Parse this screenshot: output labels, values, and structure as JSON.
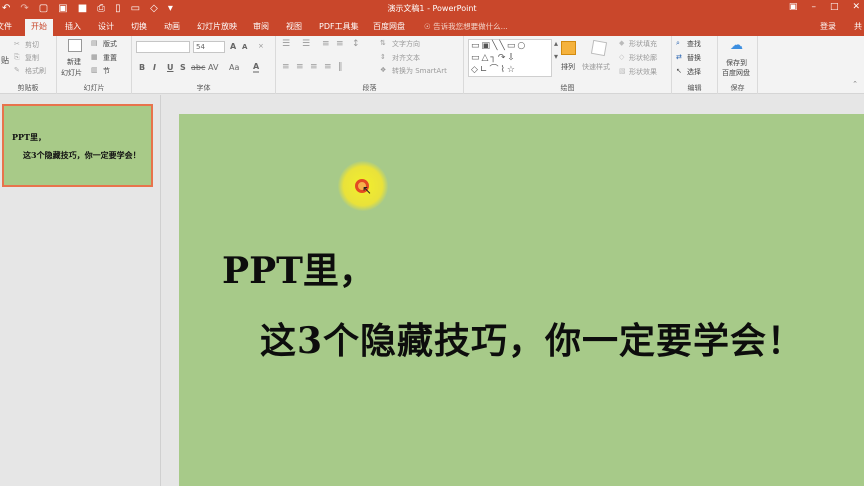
{
  "window": {
    "title": "演示文稿1 - PowerPoint",
    "login": "登录",
    "share_glyph": "共"
  },
  "tabs": [
    {
      "label": "文件"
    },
    {
      "label": "开始"
    },
    {
      "label": "插入"
    },
    {
      "label": "设计"
    },
    {
      "label": "切换"
    },
    {
      "label": "动画"
    },
    {
      "label": "幻灯片放映"
    },
    {
      "label": "审阅"
    },
    {
      "label": "视图"
    },
    {
      "label": "PDF工具集"
    },
    {
      "label": "百度网盘"
    }
  ],
  "active_tab": "开始",
  "tell_me": "告诉我您想要做什么...",
  "ribbon": {
    "clipboard": {
      "paste_glyph": "贴",
      "cut": "剪切",
      "copy": "复制",
      "format_painter": "格式刷",
      "label": "剪贴板"
    },
    "slides": {
      "new_slide_1": "新建",
      "new_slide_2": "幻灯片",
      "layout": "版式",
      "reset": "重置",
      "section": "节",
      "label": "幻灯片"
    },
    "font": {
      "size": "54",
      "bold": "B",
      "italic": "I",
      "underline": "U",
      "shadow": "S",
      "strike": "abc",
      "spacing": "AV",
      "case": "Aa",
      "color": "A",
      "grow": "A",
      "shrink": "A",
      "label": "字体"
    },
    "paragraph": {
      "text_direction": "文字方向",
      "align_text": "对齐文本",
      "smartart": "转换为 SmartArt",
      "label": "段落"
    },
    "drawing": {
      "arrange": "排列",
      "quick_styles": "快速样式",
      "shape_fill": "形状填充",
      "shape_outline": "形状轮廓",
      "shape_effects": "形状效果",
      "label": "绘图"
    },
    "editing": {
      "find": "查找",
      "replace": "替换",
      "select": "选择",
      "label": "编辑"
    },
    "save": {
      "save_to_1": "保存到",
      "save_to_2": "百度网盘",
      "label": "保存"
    }
  },
  "thumbnail": {
    "line1": "PPT里，",
    "line2": "这3个隐藏技巧，你一定要学会！"
  },
  "slide": {
    "line1": "PPT里，",
    "line2": "这3个隐藏技巧，你一定要学会！"
  },
  "colors": {
    "accent": "#c9472b",
    "slide_bg": "#a7ca89",
    "thumb_border": "#e8734c"
  }
}
